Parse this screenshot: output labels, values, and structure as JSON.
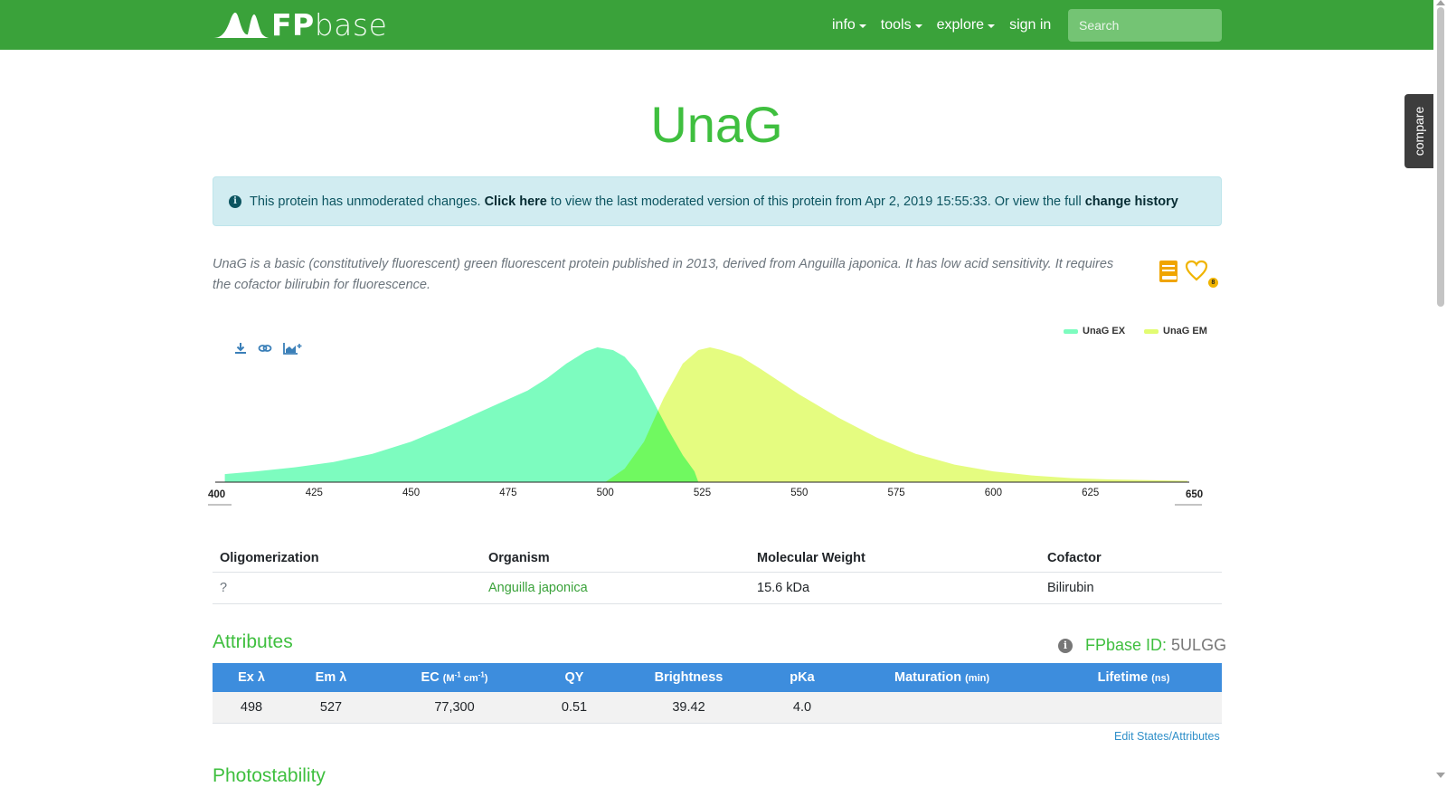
{
  "navbar": {
    "brand_bold": "FP",
    "brand_light": "base",
    "items": [
      {
        "label": "info",
        "dropdown": true
      },
      {
        "label": "tools",
        "dropdown": true
      },
      {
        "label": "explore",
        "dropdown": true
      },
      {
        "label": "sign in",
        "dropdown": false
      }
    ],
    "search_placeholder": "Search"
  },
  "compare_tab": "compare",
  "protein": {
    "name": "UnaG",
    "description": "UnaG is a basic (constitutively fluorescent) green fluorescent protein published in 2013, derived from Anguilla japonica. It has low acid sensitivity. It requires the cofactor bilirubin for fluorescence.",
    "favorite_count": "8"
  },
  "alert": {
    "icon": "info-circle-icon",
    "text1": "This protein has unmoderated changes.",
    "link1": "Click here",
    "text2": "to view the last moderated version of this protein from Apr 2, 2019 15:55:33. Or view the full",
    "link2": "change history"
  },
  "chart_data": {
    "type": "area",
    "xlim": [
      400,
      650
    ],
    "x_ticks": [
      "400",
      "425",
      "450",
      "475",
      "500",
      "525",
      "550",
      "575",
      "600",
      "625",
      "650"
    ],
    "ylim": [
      0,
      1
    ],
    "grid": false,
    "legend_position": "top-right",
    "series": [
      {
        "name": "UnaG EX",
        "color": "#7dfcbf",
        "x": [
          402,
          410,
          420,
          430,
          440,
          450,
          460,
          470,
          480,
          485,
          490,
          495,
          498,
          502,
          505,
          508,
          512,
          516,
          520,
          523,
          524
        ],
        "y": [
          0.06,
          0.08,
          0.11,
          0.15,
          0.21,
          0.3,
          0.42,
          0.55,
          0.68,
          0.77,
          0.88,
          0.97,
          1.0,
          0.98,
          0.93,
          0.83,
          0.62,
          0.4,
          0.2,
          0.08,
          0.0
        ]
      },
      {
        "name": "UnaG EM",
        "color": "#e2fc72",
        "x": [
          500,
          505,
          510,
          515,
          520,
          524,
          527,
          530,
          535,
          540,
          550,
          560,
          570,
          580,
          590,
          600,
          610,
          620,
          630,
          640,
          650
        ],
        "y": [
          0.0,
          0.1,
          0.3,
          0.62,
          0.88,
          0.98,
          1.0,
          0.98,
          0.93,
          0.84,
          0.65,
          0.48,
          0.33,
          0.21,
          0.13,
          0.08,
          0.05,
          0.03,
          0.02,
          0.015,
          0.01
        ]
      }
    ]
  },
  "chart_tools": [
    {
      "icon": "download-icon"
    },
    {
      "icon": "link-icon"
    },
    {
      "icon": "add-to-chart-icon"
    }
  ],
  "info_table": {
    "headers": [
      "Oligomerization",
      "Organism",
      "Molecular Weight",
      "Cofactor"
    ],
    "row": [
      "?",
      "Anguilla japonica",
      "15.6 kDa",
      "Bilirubin"
    ]
  },
  "attributes": {
    "title": "Attributes",
    "fpbase_id_label": "FPbase ID:",
    "fpbase_id": "5ULGG",
    "headers": [
      {
        "label": "Ex λ"
      },
      {
        "label": "Em λ"
      },
      {
        "label": "EC",
        "unit_html": "(M-1 cm-1)"
      },
      {
        "label": "QY"
      },
      {
        "label": "Brightness"
      },
      {
        "label": "pKa"
      },
      {
        "label": "Maturation",
        "unit": "(min)"
      },
      {
        "label": "Lifetime",
        "unit": "(ns)"
      }
    ],
    "row": [
      "498",
      "527",
      "77,300",
      "0.51",
      "39.42",
      "4.0",
      "",
      ""
    ],
    "edit_link": "Edit States/Attributes"
  },
  "photostability": {
    "title": "Photostability"
  }
}
